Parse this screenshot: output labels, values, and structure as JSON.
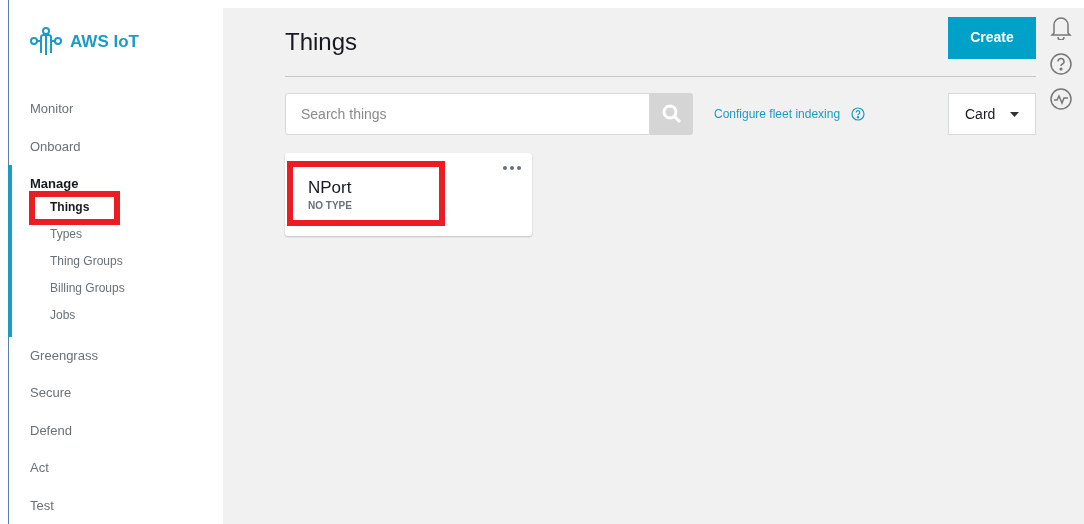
{
  "brand": {
    "name": "AWS IoT"
  },
  "sidebar": {
    "items": [
      {
        "label": "Monitor",
        "active": false
      },
      {
        "label": "Onboard",
        "active": false
      },
      {
        "label": "Manage",
        "active": true,
        "children": [
          {
            "label": "Things",
            "selected": true,
            "highlighted": true
          },
          {
            "label": "Types",
            "selected": false,
            "highlighted": false
          },
          {
            "label": "Thing Groups",
            "selected": false,
            "highlighted": false
          },
          {
            "label": "Billing Groups",
            "selected": false,
            "highlighted": false
          },
          {
            "label": "Jobs",
            "selected": false,
            "highlighted": false
          }
        ]
      },
      {
        "label": "Greengrass",
        "active": false
      },
      {
        "label": "Secure",
        "active": false
      },
      {
        "label": "Defend",
        "active": false
      },
      {
        "label": "Act",
        "active": false
      },
      {
        "label": "Test",
        "active": false
      }
    ]
  },
  "page": {
    "title": "Things",
    "create_button": "Create"
  },
  "search": {
    "placeholder": "Search things"
  },
  "fleet_link": "Configure fleet indexing",
  "view_select": {
    "value": "Card"
  },
  "cards": [
    {
      "name": "NPort",
      "type": "NO TYPE",
      "highlighted": true
    }
  ]
}
